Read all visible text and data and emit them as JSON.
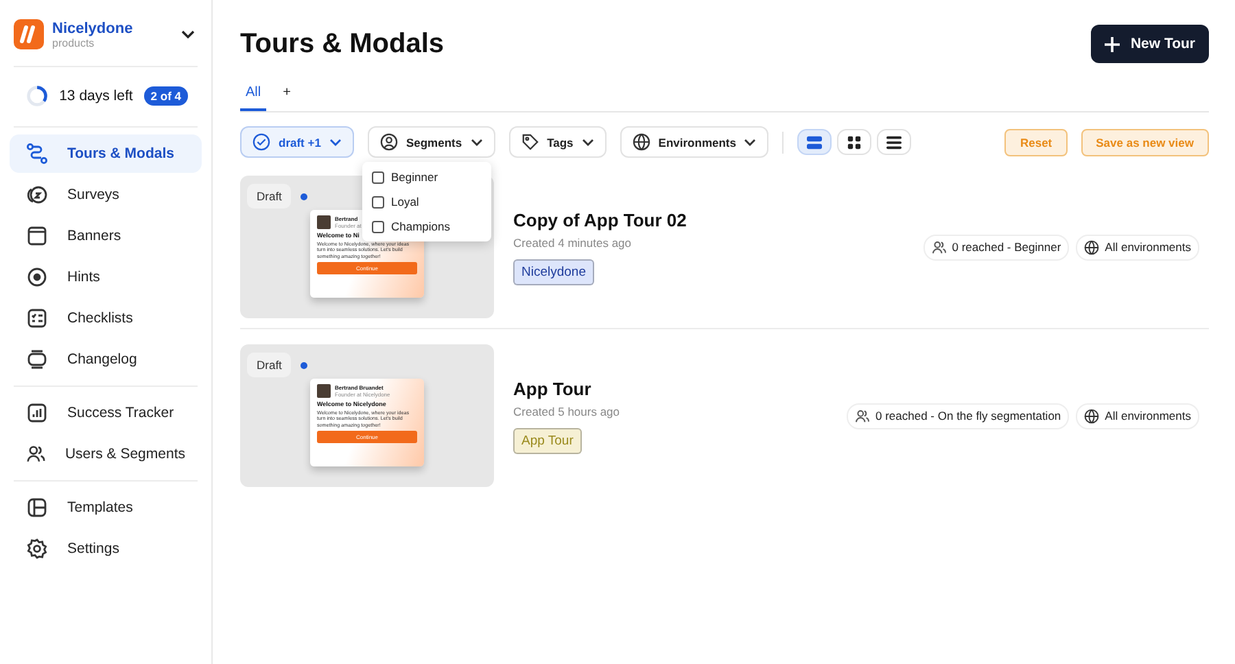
{
  "workspace": {
    "name": "Nicelydone",
    "subtitle": "products"
  },
  "trial": {
    "label": "13 days left",
    "badge": "2 of 4",
    "level": 0.35
  },
  "sidebar": {
    "groups": [
      [
        {
          "label": "Tours & Modals",
          "selected": true
        },
        {
          "label": "Surveys",
          "selected": false
        },
        {
          "label": "Banners",
          "selected": false
        },
        {
          "label": "Hints",
          "selected": false
        },
        {
          "label": "Checklists",
          "selected": false
        },
        {
          "label": "Changelog",
          "selected": false
        }
      ],
      [
        {
          "label": "Success Tracker",
          "selected": false
        },
        {
          "label": "Users & Segments",
          "selected": false
        }
      ],
      [
        {
          "label": "Templates",
          "selected": false
        },
        {
          "label": "Settings",
          "selected": false
        }
      ]
    ]
  },
  "page": {
    "title": "Tours & Modals",
    "new_button": "New Tour"
  },
  "tabs": [
    {
      "label": "All",
      "selected": true
    },
    {
      "label": "+",
      "selected": false
    }
  ],
  "filters": [
    {
      "label": "draft +1",
      "selected": true
    },
    {
      "label": "Segments",
      "selected": false
    },
    {
      "label": "Tags",
      "selected": false
    },
    {
      "label": "Environments",
      "selected": false
    }
  ],
  "views": [
    {
      "selected": true
    },
    {
      "selected": false
    },
    {
      "selected": false
    }
  ],
  "actions": [
    "Reset",
    "Save as new view"
  ],
  "segments_menu": [
    {
      "label": "Beginner",
      "checked": false
    },
    {
      "label": "Loyal",
      "checked": false
    },
    {
      "label": "Champions",
      "checked": false
    }
  ],
  "tours": [
    {
      "status": "Draft",
      "title": "Copy of App Tour 02",
      "created": "Created 4 minutes ago",
      "tag": {
        "label": "Nicelydone",
        "color": "#dde5fb"
      },
      "reach": "0 reached - Beginner",
      "environment": "All environments",
      "preview": {
        "author": "Bertrand",
        "role": "Founder at",
        "heading": "Welcome to Ni",
        "body": "Welcome to Nicelydone, where your ideas turn into seamless solutions. Let's build something amazing together!",
        "button": "Continue"
      }
    },
    {
      "status": "Draft",
      "title": "App Tour",
      "created": "Created 5 hours ago",
      "tag": {
        "label": "App Tour",
        "color": "#f6f0d4"
      },
      "reach": "0 reached - On the fly segmentation",
      "environment": "All environments",
      "preview": {
        "author": "Bertrand Bruandet",
        "role": "Founder at Nicelydone",
        "heading": "Welcome to Nicelydone",
        "body": "Welcome to Nicelydone, where your ideas turn into seamless solutions. Let's build something amazing together!",
        "button": "Continue"
      }
    }
  ]
}
